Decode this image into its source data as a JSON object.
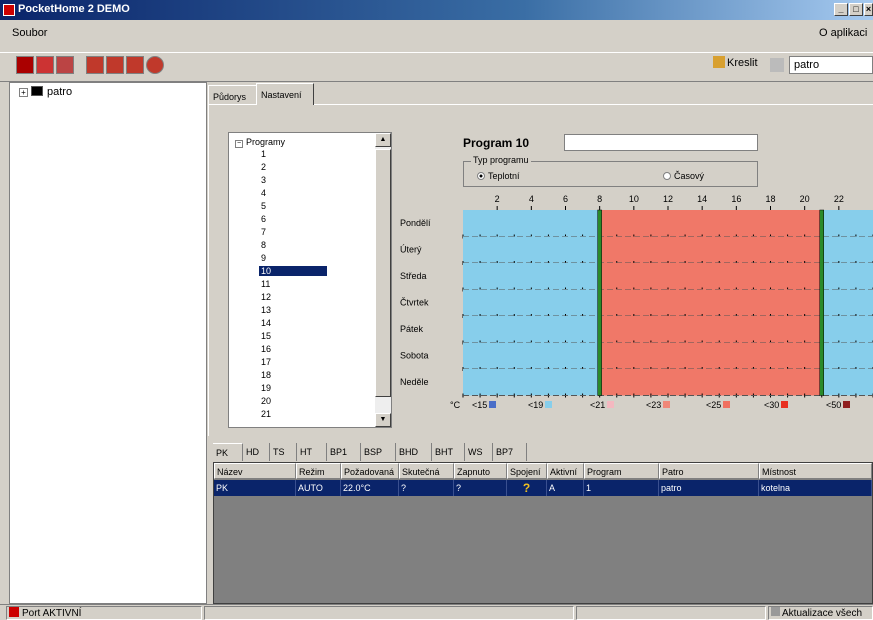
{
  "window": {
    "title": "PocketHome 2 DEMO",
    "controls": [
      "_",
      "□",
      "×"
    ]
  },
  "menu": {
    "left": "Soubor",
    "right": "O aplikaci"
  },
  "toolbar": {
    "draw_label": "Kreslit",
    "floor_value": "patro"
  },
  "tree": {
    "root": "patro"
  },
  "tabs": [
    "Půdorys",
    "Nastavení"
  ],
  "programs": {
    "root": "Programy",
    "items": [
      "1",
      "2",
      "3",
      "4",
      "5",
      "6",
      "7",
      "8",
      "9",
      "10",
      "11",
      "12",
      "13",
      "14",
      "15",
      "16",
      "17",
      "18",
      "19",
      "20",
      "21"
    ],
    "selected": "10"
  },
  "program": {
    "title": "Program 10",
    "name_value": "",
    "type_group": "Typ programu",
    "type_options": [
      "Teplotní",
      "Časový"
    ],
    "type_selected": "Teplotní"
  },
  "schedule": {
    "hour_labels": [
      "2",
      "4",
      "6",
      "8",
      "10",
      "12",
      "14",
      "16",
      "18",
      "20",
      "22"
    ],
    "days": [
      "Pondělí",
      "Úterý",
      "Středa",
      "Čtvrtek",
      "Pátek",
      "Sobota",
      "Neděle"
    ],
    "blocks": [
      {
        "from": 0,
        "to": 8,
        "level": "<19",
        "color": "#87ceeb"
      },
      {
        "from": 8,
        "to": 21,
        "level": "<23",
        "color": "#f07868"
      },
      {
        "from": 21,
        "to": 24,
        "level": "<19",
        "color": "#87ceeb"
      }
    ],
    "unit": "°C",
    "legend": [
      {
        "label": "<15",
        "color": "#4a6ec8"
      },
      {
        "label": "<19",
        "color": "#87ceeb"
      },
      {
        "label": "<21",
        "color": "#f4b8c0"
      },
      {
        "label": "<23",
        "color": "#f08878"
      },
      {
        "label": "<25",
        "color": "#f07060"
      },
      {
        "label": "<30",
        "color": "#e83020"
      },
      {
        "label": "<50",
        "color": "#902020"
      }
    ]
  },
  "bottom_tabs": [
    "PK",
    "HD",
    "TS",
    "HT",
    "BP1",
    "BSP",
    "BHD",
    "BHT",
    "WS",
    "BP7"
  ],
  "table": {
    "columns": [
      "Název",
      "Režim",
      "Požadovaná",
      "Skutečná",
      "Zapnuto",
      "Spojení",
      "Aktivní",
      "Program",
      "Patro",
      "Místnost"
    ],
    "rows": [
      [
        "PK",
        "AUTO",
        "22.0°C",
        "?",
        "?",
        "?",
        "A",
        "1",
        "patro",
        "kotelna"
      ]
    ]
  },
  "status": {
    "port": "Port AKTIVNÍ",
    "update": "Aktualizace všech"
  }
}
